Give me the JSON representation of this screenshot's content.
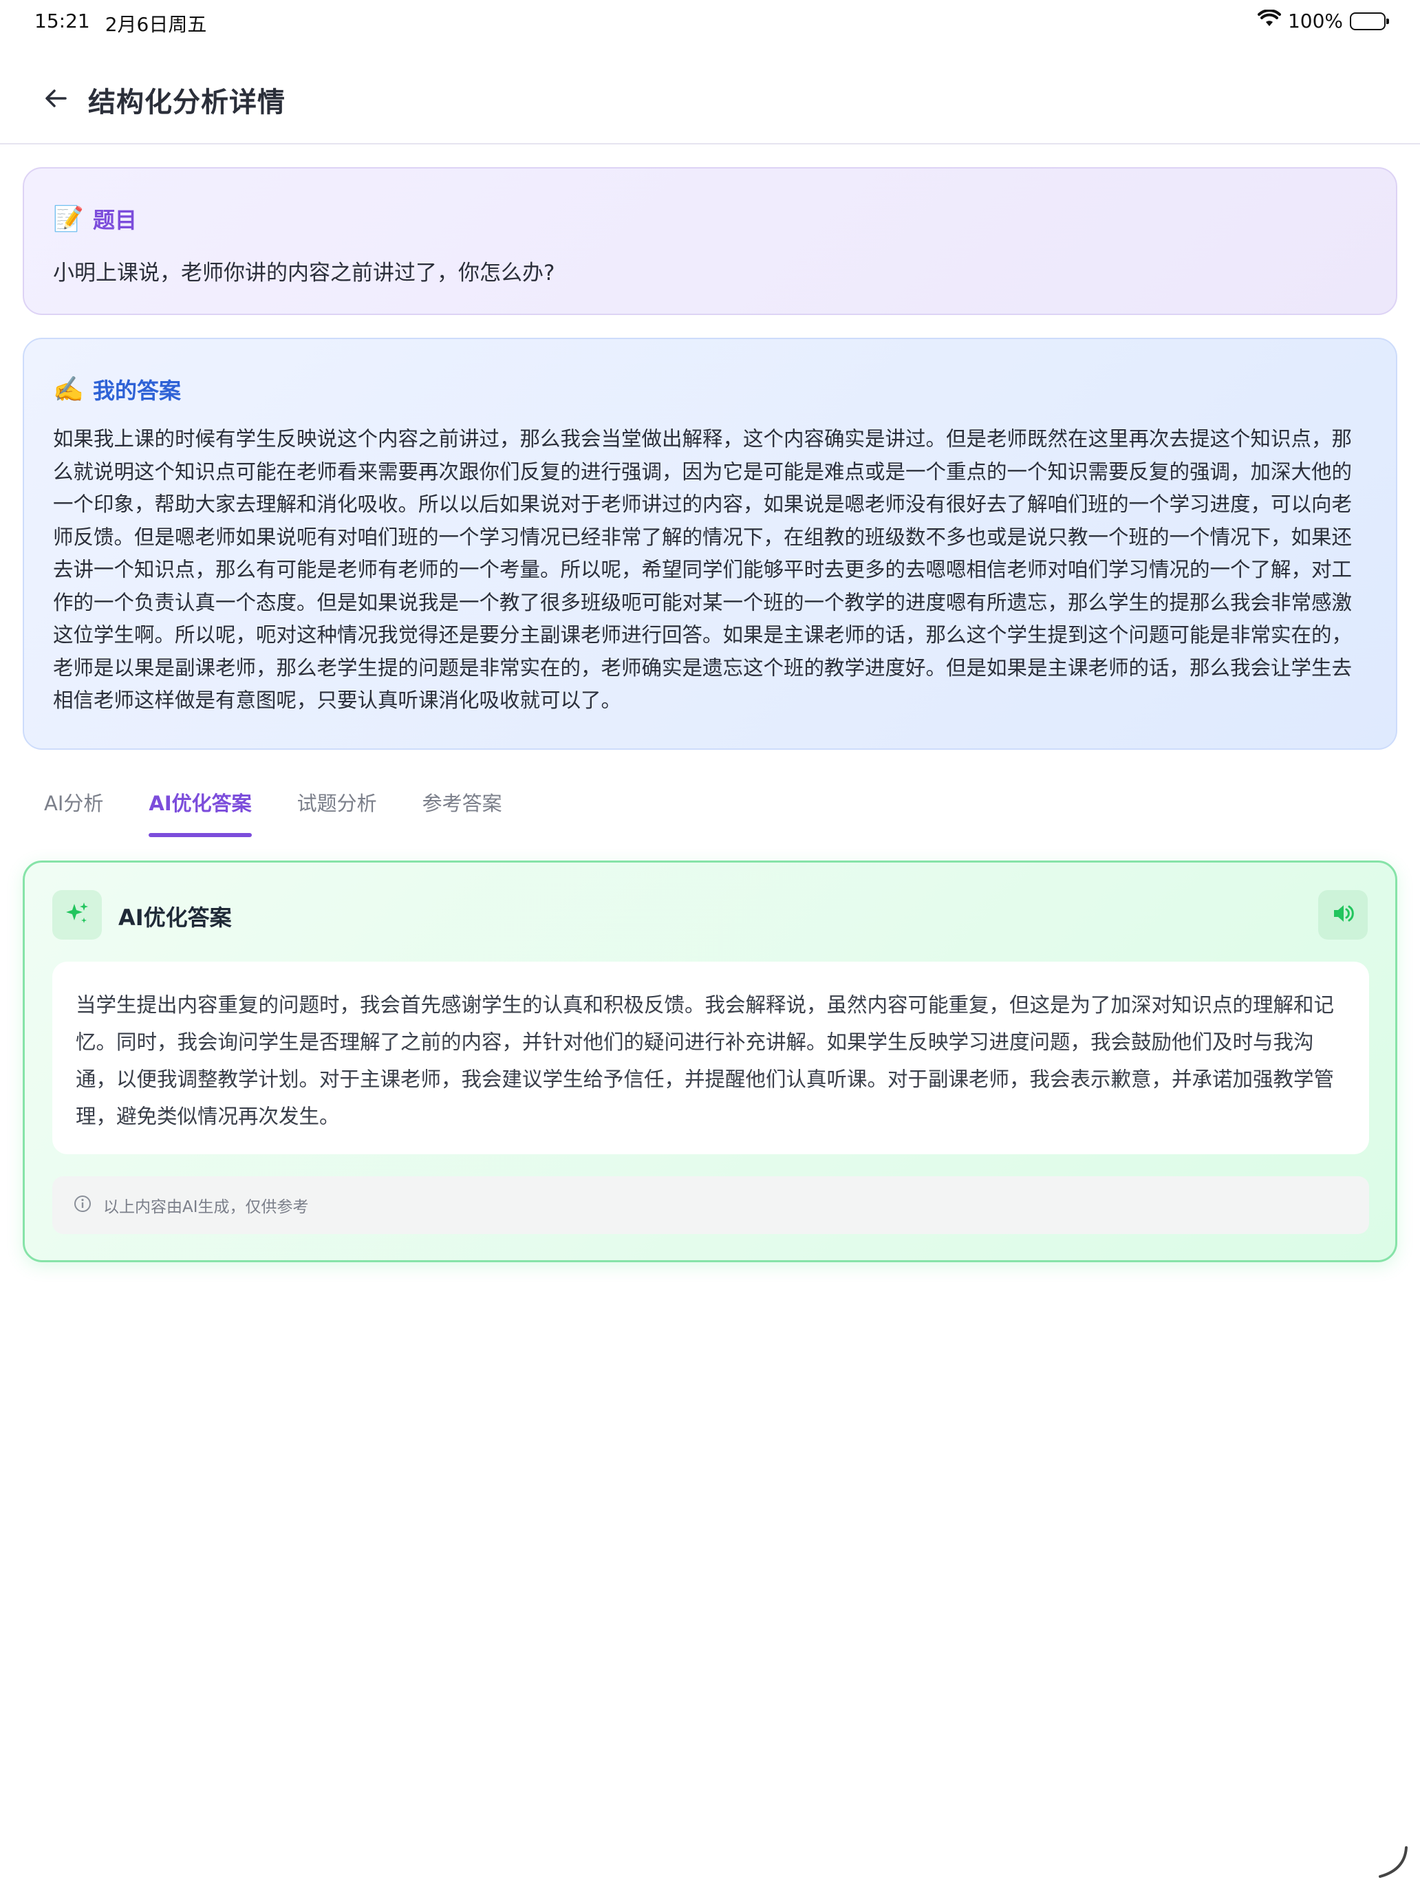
{
  "status_bar": {
    "time": "15:21",
    "date": "2月6日周五",
    "battery": "100%"
  },
  "header": {
    "title": "结构化分析详情"
  },
  "question": {
    "emoji": "📝",
    "title": "题目",
    "text": "小明上课说，老师你讲的内容之前讲过了，你怎么办?"
  },
  "my_answer": {
    "emoji": "✍️",
    "title": "我的答案",
    "text": "如果我上课的时候有学生反映说这个内容之前讲过，那么我会当堂做出解释，这个内容确实是讲过。但是老师既然在这里再次去提这个知识点，那么就说明这个知识点可能在老师看来需要再次跟你们反复的进行强调，因为它是可能是难点或是一个重点的一个知识需要反复的强调，加深大他的一个印象，帮助大家去理解和消化吸收。所以以后如果说对于老师讲过的内容，如果说是嗯老师没有很好去了解咱们班的一个学习进度，可以向老师反馈。但是嗯老师如果说呃有对咱们班的一个学习情况已经非常了解的情况下，在组教的班级数不多也或是说只教一个班的一个情况下，如果还去讲一个知识点，那么有可能是老师有老师的一个考量。所以呢，希望同学们能够平时去更多的去嗯嗯相信老师对咱们学习情况的一个了解，对工作的一个负责认真一个态度。但是如果说我是一个教了很多班级呃可能对某一个班的一个教学的进度嗯有所遗忘，那么学生的提那么我会非常感激这位学生啊。所以呢，呃对这种情况我觉得还是要分主副课老师进行回答。如果是主课老师的话，那么这个学生提到这个问题可能是非常实在的，老师是以果是副课老师，那么老学生提的问题是非常实在的，老师确实是遗忘这个班的教学进度好。但是如果是主课老师的话，那么我会让学生去相信老师这样做是有意图呢，只要认真听课消化吸收就可以了。"
  },
  "tabs": [
    {
      "label": "AI分析",
      "active": false
    },
    {
      "label": "AI优化答案",
      "active": true
    },
    {
      "label": "试题分析",
      "active": false
    },
    {
      "label": "参考答案",
      "active": false
    }
  ],
  "ai_optimized": {
    "title": "AI优化答案",
    "text": "当学生提出内容重复的问题时，我会首先感谢学生的认真和积极反馈。我会解释说，虽然内容可能重复，但这是为了加深对知识点的理解和记忆。同时，我会询问学生是否理解了之前的内容，并针对他们的疑问进行补充讲解。如果学生反映学习进度问题，我会鼓励他们及时与我沟通，以便我调整教学计划。对于主课老师，我会建议学生给予信任，并提醒他们认真听课。对于副课老师，我会表示歉意，并承诺加强教学管理，避免类似情况再次发生。",
    "disclaimer": "以上内容由AI生成，仅供参考"
  },
  "colors": {
    "accent_purple": "#7c4ddb",
    "accent_blue": "#2e62d6",
    "accent_green": "#22c55e"
  }
}
